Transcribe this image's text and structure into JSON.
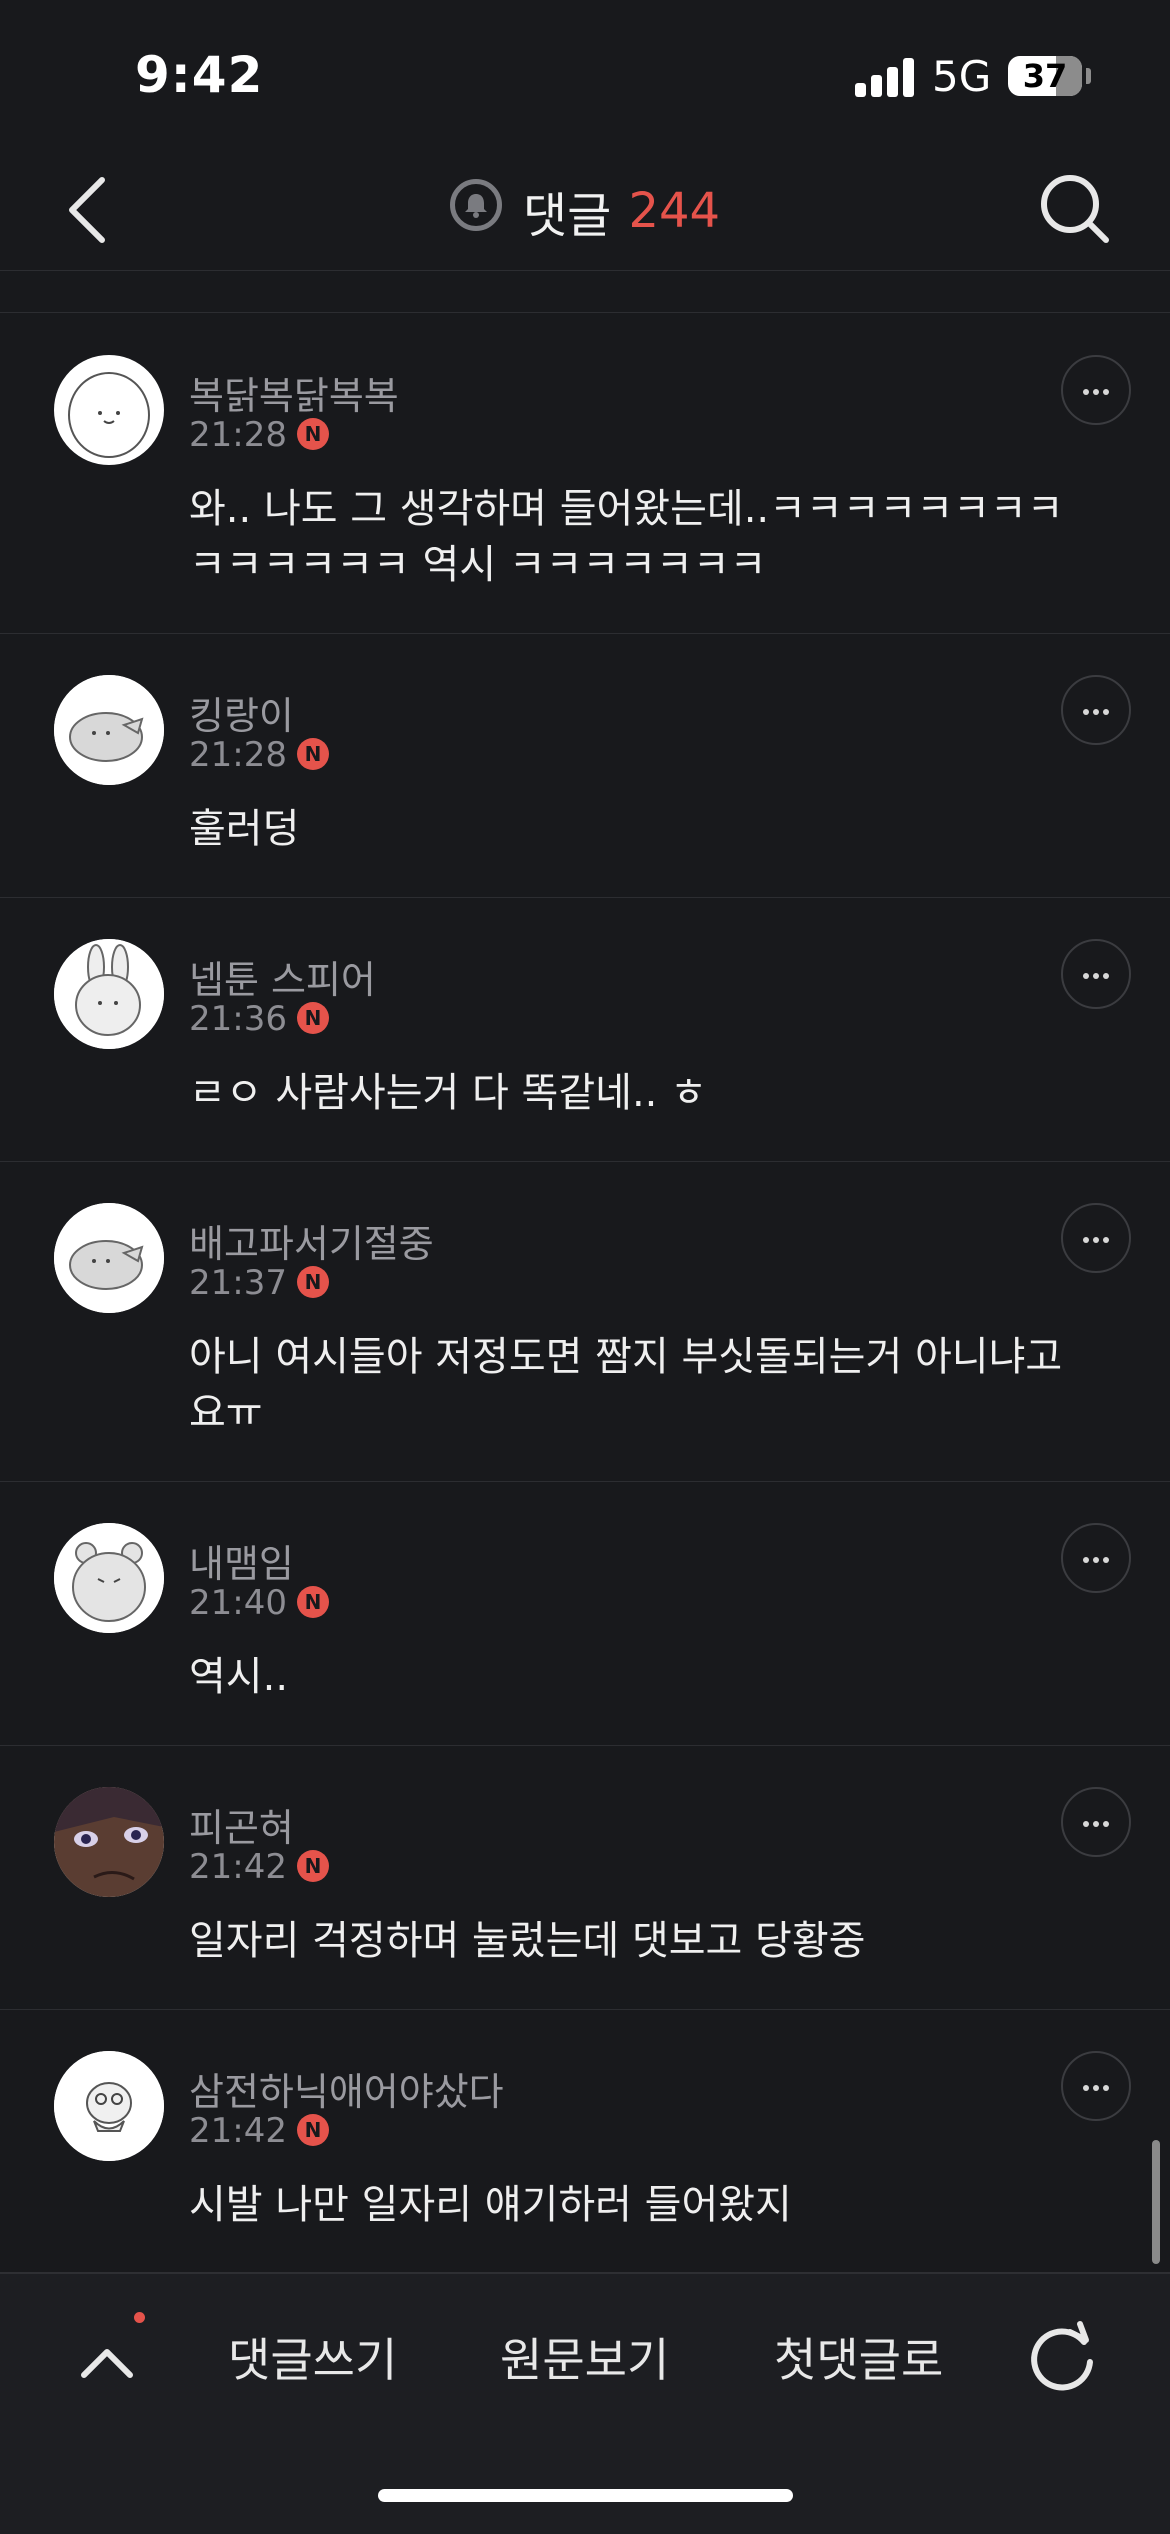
{
  "status_bar": {
    "time": "9:42",
    "network": "5G",
    "battery": "37"
  },
  "header": {
    "title": "댓글",
    "count": "244"
  },
  "comments": [
    {
      "name": "복닭복닭복복",
      "time": "21:28",
      "badge": "N",
      "text": "와.. 나도 그 생각하며 들어왔는데..ㅋㅋㅋㅋㅋㅋㅋㅋㅋㅋㅋㅋㅋㅋ 역시 ㅋㅋㅋㅋㅋㅋㅋ"
    },
    {
      "name": "킹랑이",
      "time": "21:28",
      "badge": "N",
      "text": "훌러덩"
    },
    {
      "name": "넵툰 스피어",
      "time": "21:36",
      "badge": "N",
      "text": "ㄹㅇ 사람사는거 다 똑같네.. ㅎ"
    },
    {
      "name": "배고파서기절중",
      "time": "21:37",
      "badge": "N",
      "text": "아니 여시들아 저정도면 짬지 부싯돌되는거 아니냐고요ㅠ"
    },
    {
      "name": "내맴임",
      "time": "21:40",
      "badge": "N",
      "text": "역시.."
    },
    {
      "name": "피곤혀",
      "time": "21:42",
      "badge": "N",
      "text": "일자리 걱정하며 눌렀는데 댓보고 당황중"
    },
    {
      "name": "삼전하닉애어야샀다",
      "time": "21:42",
      "badge": "N",
      "text": "시발 나만 일자리 얘기하러 들어왔지"
    }
  ],
  "bottom_bar": {
    "write": "댓글쓰기",
    "original": "원문보기",
    "first": "첫댓글로"
  },
  "colors": {
    "accent": "#e5534b",
    "background": "#18191c"
  }
}
